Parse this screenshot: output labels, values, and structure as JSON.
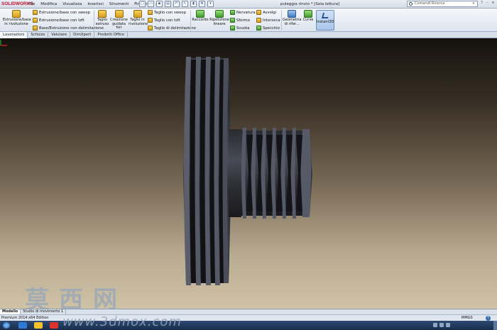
{
  "app": {
    "logo_text": "SOLIDWORKS",
    "document_title": "puleggia rinvio * [Sola lettura]",
    "menu": [
      "File",
      "Modifica",
      "Visualizza",
      "Inserisci",
      "Strumenti",
      "Finestra"
    ],
    "more_glyph": "»",
    "search_placeholder": "Comandi Ricerca"
  },
  "ribbon": {
    "extrude_label": "Estrusione/base in rivoluzione",
    "sweep_label": "Estrusione/base con sweep",
    "loft_label": "Estrusione/base con loft",
    "boundary_label": "Base/Estrusione con delimitazione",
    "cut_extrude_label": "Taglio estruso",
    "hole_wizard_label": "Creazione guidata fori",
    "cut_revolve_label": "Taglio in rivoluzione",
    "cut_sweep_label": "Taglio con sweep",
    "cut_loft_label": "Taglio con loft",
    "cut_boundary_label": "Taglio di delimitazione",
    "fillet_label": "Raccordo",
    "linear_pattern_label": "Ripetizione lineare",
    "rib_label": "Nervatura",
    "draft_label": "Sformo",
    "shell_label": "Svuota",
    "wrap_label": "Avvolgi",
    "intersect_label": "Interseca",
    "mirror_label": "Specchio",
    "ref_geometry_label": "Geometria di rifer...",
    "curves_label": "Curve",
    "instant3d_label": "Instant3D"
  },
  "tabs": [
    "Lavorazioni",
    "Schizzo",
    "Valutare",
    "DimXpert",
    "Prodotti Office"
  ],
  "bottom_tabs": [
    "Modello",
    "Studio di movimento 1"
  ],
  "status": {
    "left_text": "Premium 2014 x64 Edition",
    "units": "MMGS",
    "help_glyph": "?"
  },
  "watermark": {
    "chinese": "莫西网",
    "url": "www.3dmox.com"
  },
  "colors": {
    "pulley_dark": "#1d1d22",
    "pulley_highlight": "#5a5f6b",
    "ribbon_accent": "#3d7ac2"
  },
  "icons": [
    "search-icon",
    "help-icon",
    "instant3d-icon",
    "triad-icon"
  ]
}
